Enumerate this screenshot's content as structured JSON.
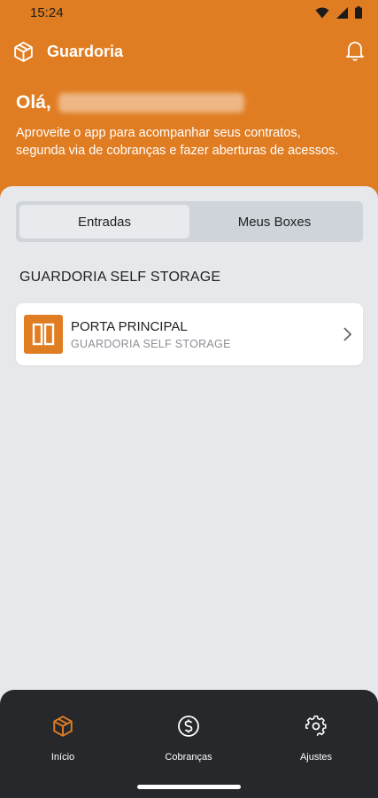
{
  "status_bar": {
    "time": "15:24"
  },
  "app": {
    "title": "Guardoria"
  },
  "header": {
    "greeting": "Olá,",
    "subtitle": "Aproveite o app para acompanhar seus contratos, segunda via de cobranças e fazer aberturas de acessos."
  },
  "tabs": [
    {
      "label": "Entradas",
      "active": true
    },
    {
      "label": "Meus Boxes",
      "active": false
    }
  ],
  "section": {
    "title": "GUARDORIA SELF STORAGE"
  },
  "entries": [
    {
      "title": "PORTA PRINCIPAL",
      "subtitle": "GUARDORIA SELF STORAGE",
      "icon": "door-icon"
    }
  ],
  "bottom_nav": [
    {
      "label": "Início",
      "icon": "box-icon",
      "active": true
    },
    {
      "label": "Cobranças",
      "icon": "dollar-icon",
      "active": false
    },
    {
      "label": "Ajustes",
      "icon": "gear-icon",
      "active": false
    }
  ],
  "colors": {
    "brand": "#e07d22",
    "nav_bg": "#26282b",
    "background": "#e6e8eb"
  }
}
